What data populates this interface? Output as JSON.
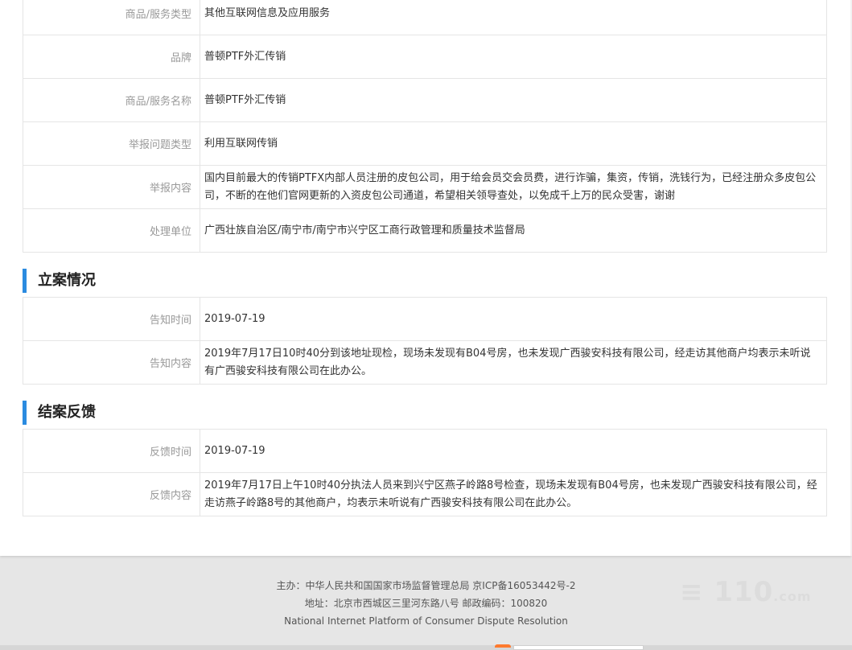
{
  "complaint": {
    "rows": [
      {
        "label": "商品/服务类型",
        "value": "其他互联网信息及应用服务"
      },
      {
        "label": "品牌",
        "value": "普顿PTF外汇传销"
      },
      {
        "label": "商品/服务名称",
        "value": "普顿PTF外汇传销"
      },
      {
        "label": "举报问题类型",
        "value": "利用互联网传销"
      },
      {
        "label": "举报内容",
        "value": "国内目前最大的传销PTFX内部人员注册的皮包公司，用于给会员交会员费，进行诈骗，集资，传销，洗钱行为，已经注册众多皮包公司，不断的在他们官网更新的入资皮包公司通道，希望相关领导查处，以免成千上万的民众受害，谢谢"
      },
      {
        "label": "处理单位",
        "value": "广西壮族自治区/南宁市/南宁市兴宁区工商行政管理和质量技术监督局"
      }
    ]
  },
  "filing": {
    "title": "立案情况",
    "rows": [
      {
        "label": "告知时间",
        "value": "2019-07-19"
      },
      {
        "label": "告知内容",
        "value": "2019年7月17日10时40分到该地址现检，现场未发现有B04号房，也未发现广西骏安科技有限公司，经走访其他商户均表示未听说有广西骏安科技有限公司在此办公。"
      }
    ]
  },
  "closing": {
    "title": "结案反馈",
    "rows": [
      {
        "label": "反馈时间",
        "value": "2019-07-19"
      },
      {
        "label": "反馈内容",
        "value": "2019年7月17日上午10时40分执法人员来到兴宁区燕子岭路8号检查，现场未发现有B04号房，也未发现广西骏安科技有限公司，经走访燕子岭路8号的其他商户，均表示未听说有广西骏安科技有限公司在此办公。"
      }
    ]
  },
  "footer": {
    "line1": "主办：中华人民共和国国家市场监督管理总局 京ICP备16053442号-2",
    "line2": "地址：北京市西城区三里河东路八号 邮政编码：100820",
    "line3": "National Internet Platform of Consumer Dispute Resolution"
  },
  "watermark": {
    "text": "≡ 110",
    "sub": ".com"
  },
  "colors": {
    "accent": "#2b8be0",
    "label": "#999999",
    "border": "#e5e5e5",
    "footer_bg": "#e6e6e6"
  }
}
